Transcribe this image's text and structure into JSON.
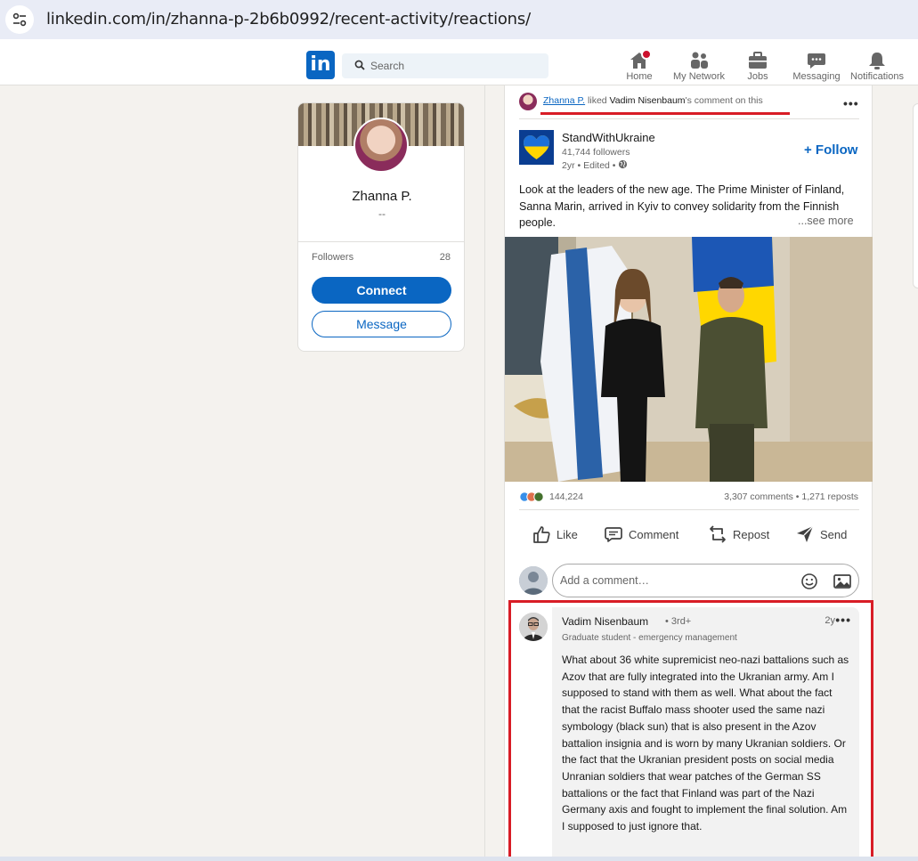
{
  "browser": {
    "url": "linkedin.com/in/zhanna-p-2b6b0992/recent-activity/reactions/"
  },
  "nav": {
    "logo": "in",
    "search_placeholder": "Search",
    "items": [
      {
        "label": "Home",
        "icon": "home-icon"
      },
      {
        "label": "My Network",
        "icon": "network-icon"
      },
      {
        "label": "Jobs",
        "icon": "briefcase-icon"
      },
      {
        "label": "Messaging",
        "icon": "messaging-icon"
      },
      {
        "label": "Notifications",
        "icon": "bell-icon"
      }
    ]
  },
  "profile": {
    "name": "Zhanna P.",
    "subtitle": "--",
    "followers_label": "Followers",
    "followers_count": "28",
    "connect_label": "Connect",
    "message_label": "Message"
  },
  "activity": {
    "actor": "Zhanna P.",
    "verb": " liked ",
    "target": "Vadim Nisenbaum",
    "suffix": "'s comment on this"
  },
  "post": {
    "org_name": "StandWithUkraine",
    "followers": "41,744 followers",
    "meta": "2yr • Edited •",
    "follow_label": "+ Follow",
    "text": "Look at the leaders of the new age. The Prime Minister of Finland, Sanna Marin, arrived in Kyiv to convey solidarity from the Finnish people.",
    "see_more": "...see more",
    "reactions_count": "144,224",
    "comments_reposts": "3,307 comments • 1,271 reposts",
    "actions": {
      "like": "Like",
      "comment": "Comment",
      "repost": "Repost",
      "send": "Send"
    },
    "comment_placeholder": "Add a comment…"
  },
  "comment": {
    "author": "Vadim Nisenbaum",
    "degree": "• 3rd+",
    "time": "2y",
    "headline": "Graduate student - emergency management",
    "text": "What about 36 white supremicist neo-nazi battalions such as Azov that are fully integrated into the Ukranian army. Am I supposed to stand with them as well. What about the fact that the racist Buffalo mass shooter used the same nazi symbology (black sun) that is also present in the Azov battalion insignia and is worn by many Ukranian soldiers. Or the fact that the Ukranian president posts on social media Unranian soldiers that wear patches of the German SS battalions or the fact that Finland was part of the Nazi Germany axis and fought to implement the final solution. Am I supposed to just ignore that."
  },
  "colors": {
    "linkedin_blue": "#0a66c2",
    "highlight_red": "#d81d26",
    "background": "#f4f2ee"
  }
}
